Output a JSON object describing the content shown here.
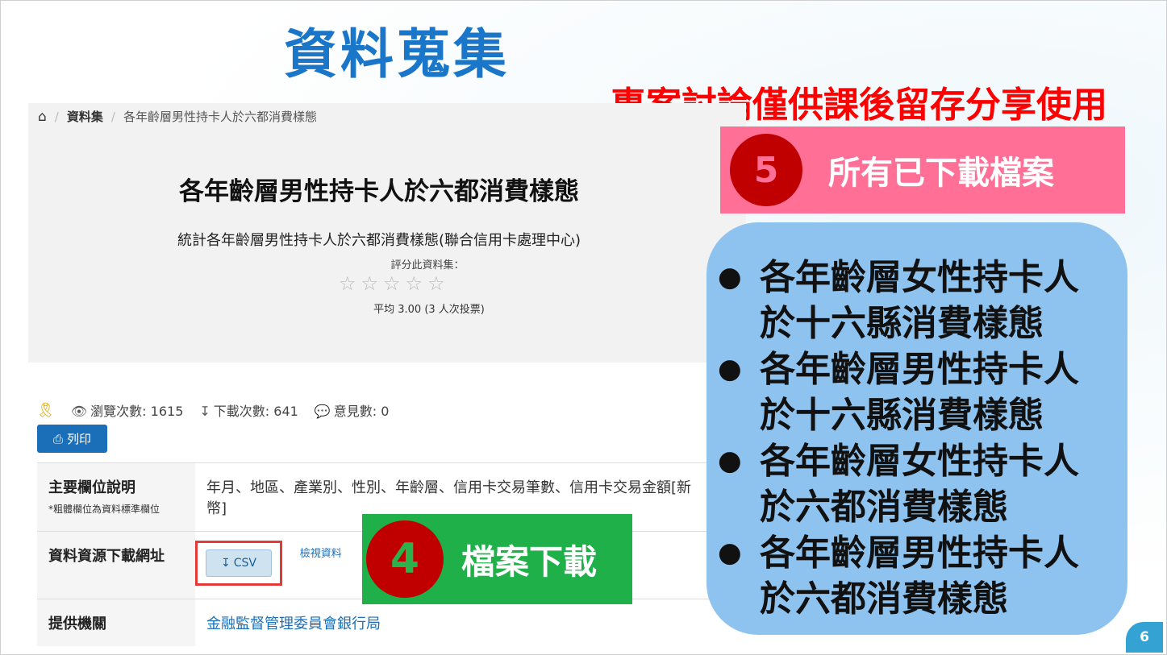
{
  "slide": {
    "title": "資料蒐集",
    "warning": "專案討論僅供課後留存分享使用",
    "page_number": "6"
  },
  "breadcrumb": {
    "home_icon": "home-icon",
    "item1": "資料集",
    "item2": "各年齡層男性持卡人於六都消費樣態"
  },
  "dataset": {
    "title": "各年齡層男性持卡人於六都消費樣態",
    "description": "統計各年齡層男性持卡人於六都消費樣態(聯合信用卡處理中心)",
    "rate_label": "評分此資料集：",
    "rating": 0,
    "average": "平均 3.00 (3 人次投票)"
  },
  "stats": {
    "views": "瀏覽次數: 1615",
    "downloads": "下載次數: 641",
    "comments": "意見數: 0"
  },
  "print_label": "列印",
  "table": {
    "row1_key": "主要欄位說明",
    "row1_note": "*粗體欄位為資料標準欄位",
    "row1_value_line1": "年月、地區、產業別、性別、年齡層、信用卡交易筆數、信用卡交易金額[新",
    "row1_value_line2": "幣]",
    "row2_key": "資料資源下載網址",
    "csv_label": "CSV",
    "view_label": "檢視資料",
    "row3_key": "提供機關",
    "row3_value": "金融監督管理委員會銀行局"
  },
  "callout4": {
    "number": "4",
    "label": "檔案下載",
    "color": "#1fb04a"
  },
  "callout5": {
    "number": "5",
    "label": "所有已下載檔案",
    "color": "#ff6f96"
  },
  "downloaded_files": [
    {
      "line1": "各年齡層女性持卡人",
      "line2": "於十六縣消費樣態"
    },
    {
      "line1": "各年齡層男性持卡人",
      "line2": "於十六縣消費樣態"
    },
    {
      "line1": "各年齡層女性持卡人",
      "line2": "於六都消費樣態"
    },
    {
      "line1": "各年齡層男性持卡人",
      "line2": "於六都消費樣態"
    }
  ]
}
